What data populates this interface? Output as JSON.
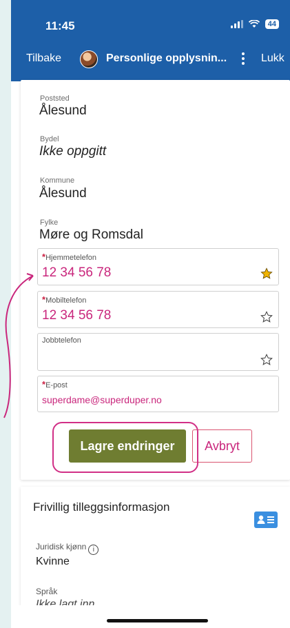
{
  "status_bar": {
    "time": "11:45",
    "battery": "44"
  },
  "nav": {
    "back": "Tilbake",
    "title": "Personlige opplysnin...",
    "close": "Lukk"
  },
  "address": [
    {
      "label": "Poststed",
      "value": "Ålesund"
    },
    {
      "label": "Bydel",
      "value": "Ikke oppgitt"
    },
    {
      "label": "Kommune",
      "value": "Ålesund"
    },
    {
      "label": "Fylke",
      "value": "Møre og Romsdal"
    }
  ],
  "phone_fields": {
    "home": {
      "required_mark": "*",
      "label": "Hjemmetelefon",
      "value": "12 34 56 78",
      "favorite": true
    },
    "mobile": {
      "required_mark": "*",
      "label": "Mobiltelefon",
      "value": "12 34 56 78",
      "favorite": false
    },
    "work": {
      "label": "Jobbtelefon",
      "value": "",
      "favorite": false
    },
    "email": {
      "required_mark": "*",
      "label": "E-post",
      "value": "superdame@superduper.no"
    }
  },
  "actions": {
    "save": "Lagre endringer",
    "cancel": "Avbryt"
  },
  "extra_section": {
    "title": "Frivillig tilleggsinformasjon",
    "gender_label": "Juridisk kjønn",
    "info_glyph": "i",
    "gender_value": "Kvinne",
    "language_label": "Språk",
    "language_value": "Ikke lagt inn"
  },
  "colors": {
    "header": "#1d5fa8",
    "accent": "#c9267c",
    "save": "#6f7d31",
    "star_filled": "#f0b400"
  }
}
